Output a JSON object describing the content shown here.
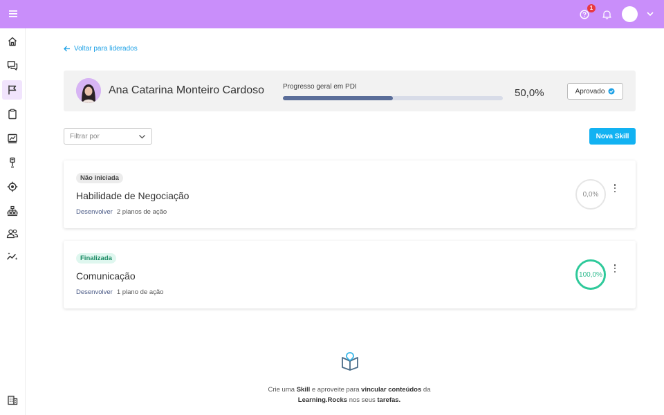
{
  "topbar": {
    "help_badge_count": "1",
    "colors": {
      "background": "#c98efa",
      "badge": "#e9393f"
    }
  },
  "sidebar": {
    "items": [
      {
        "icon": "home-icon"
      },
      {
        "icon": "chat-icon"
      },
      {
        "icon": "flag-icon",
        "active": true
      },
      {
        "icon": "clipboard-icon"
      },
      {
        "icon": "chart-icon"
      },
      {
        "icon": "award-icon"
      },
      {
        "icon": "target-icon"
      },
      {
        "icon": "org-chart-icon"
      },
      {
        "icon": "users-icon"
      },
      {
        "icon": "sparkle-trend-icon"
      }
    ],
    "footer_icon": "building-icon"
  },
  "back_link": {
    "label": "Voltar para liderados"
  },
  "person": {
    "name": "Ana Catarina Monteiro Cardoso",
    "progress_label": "Progresso geral em PDI",
    "progress_value": "50,0%",
    "progress_fraction": 0.5,
    "status_label": "Aprovado"
  },
  "filter": {
    "placeholder": "Filtrar por"
  },
  "new_skill_button": {
    "label": "Nova Skill",
    "color": "#12b2f2"
  },
  "skills": [
    {
      "status": "Não iniciada",
      "title": "Habilidade de Negociação",
      "type": "Desenvolver",
      "plans": "2 planos de ação",
      "progress": "0,0%"
    },
    {
      "status": "Finalizada",
      "title": "Comunicação",
      "type": "Desenvolver",
      "plans": "1 plano de ação",
      "progress": "100,0%"
    }
  ],
  "empty_state": {
    "text_1": "Crie uma ",
    "bold_1": "Skill",
    "text_2": " e aproveite para ",
    "bold_2": "vincular conteúdos",
    "text_3": " da ",
    "bold_3": "Learning.Rocks",
    "text_4": " nos seus ",
    "bold_4": "tarefas."
  }
}
